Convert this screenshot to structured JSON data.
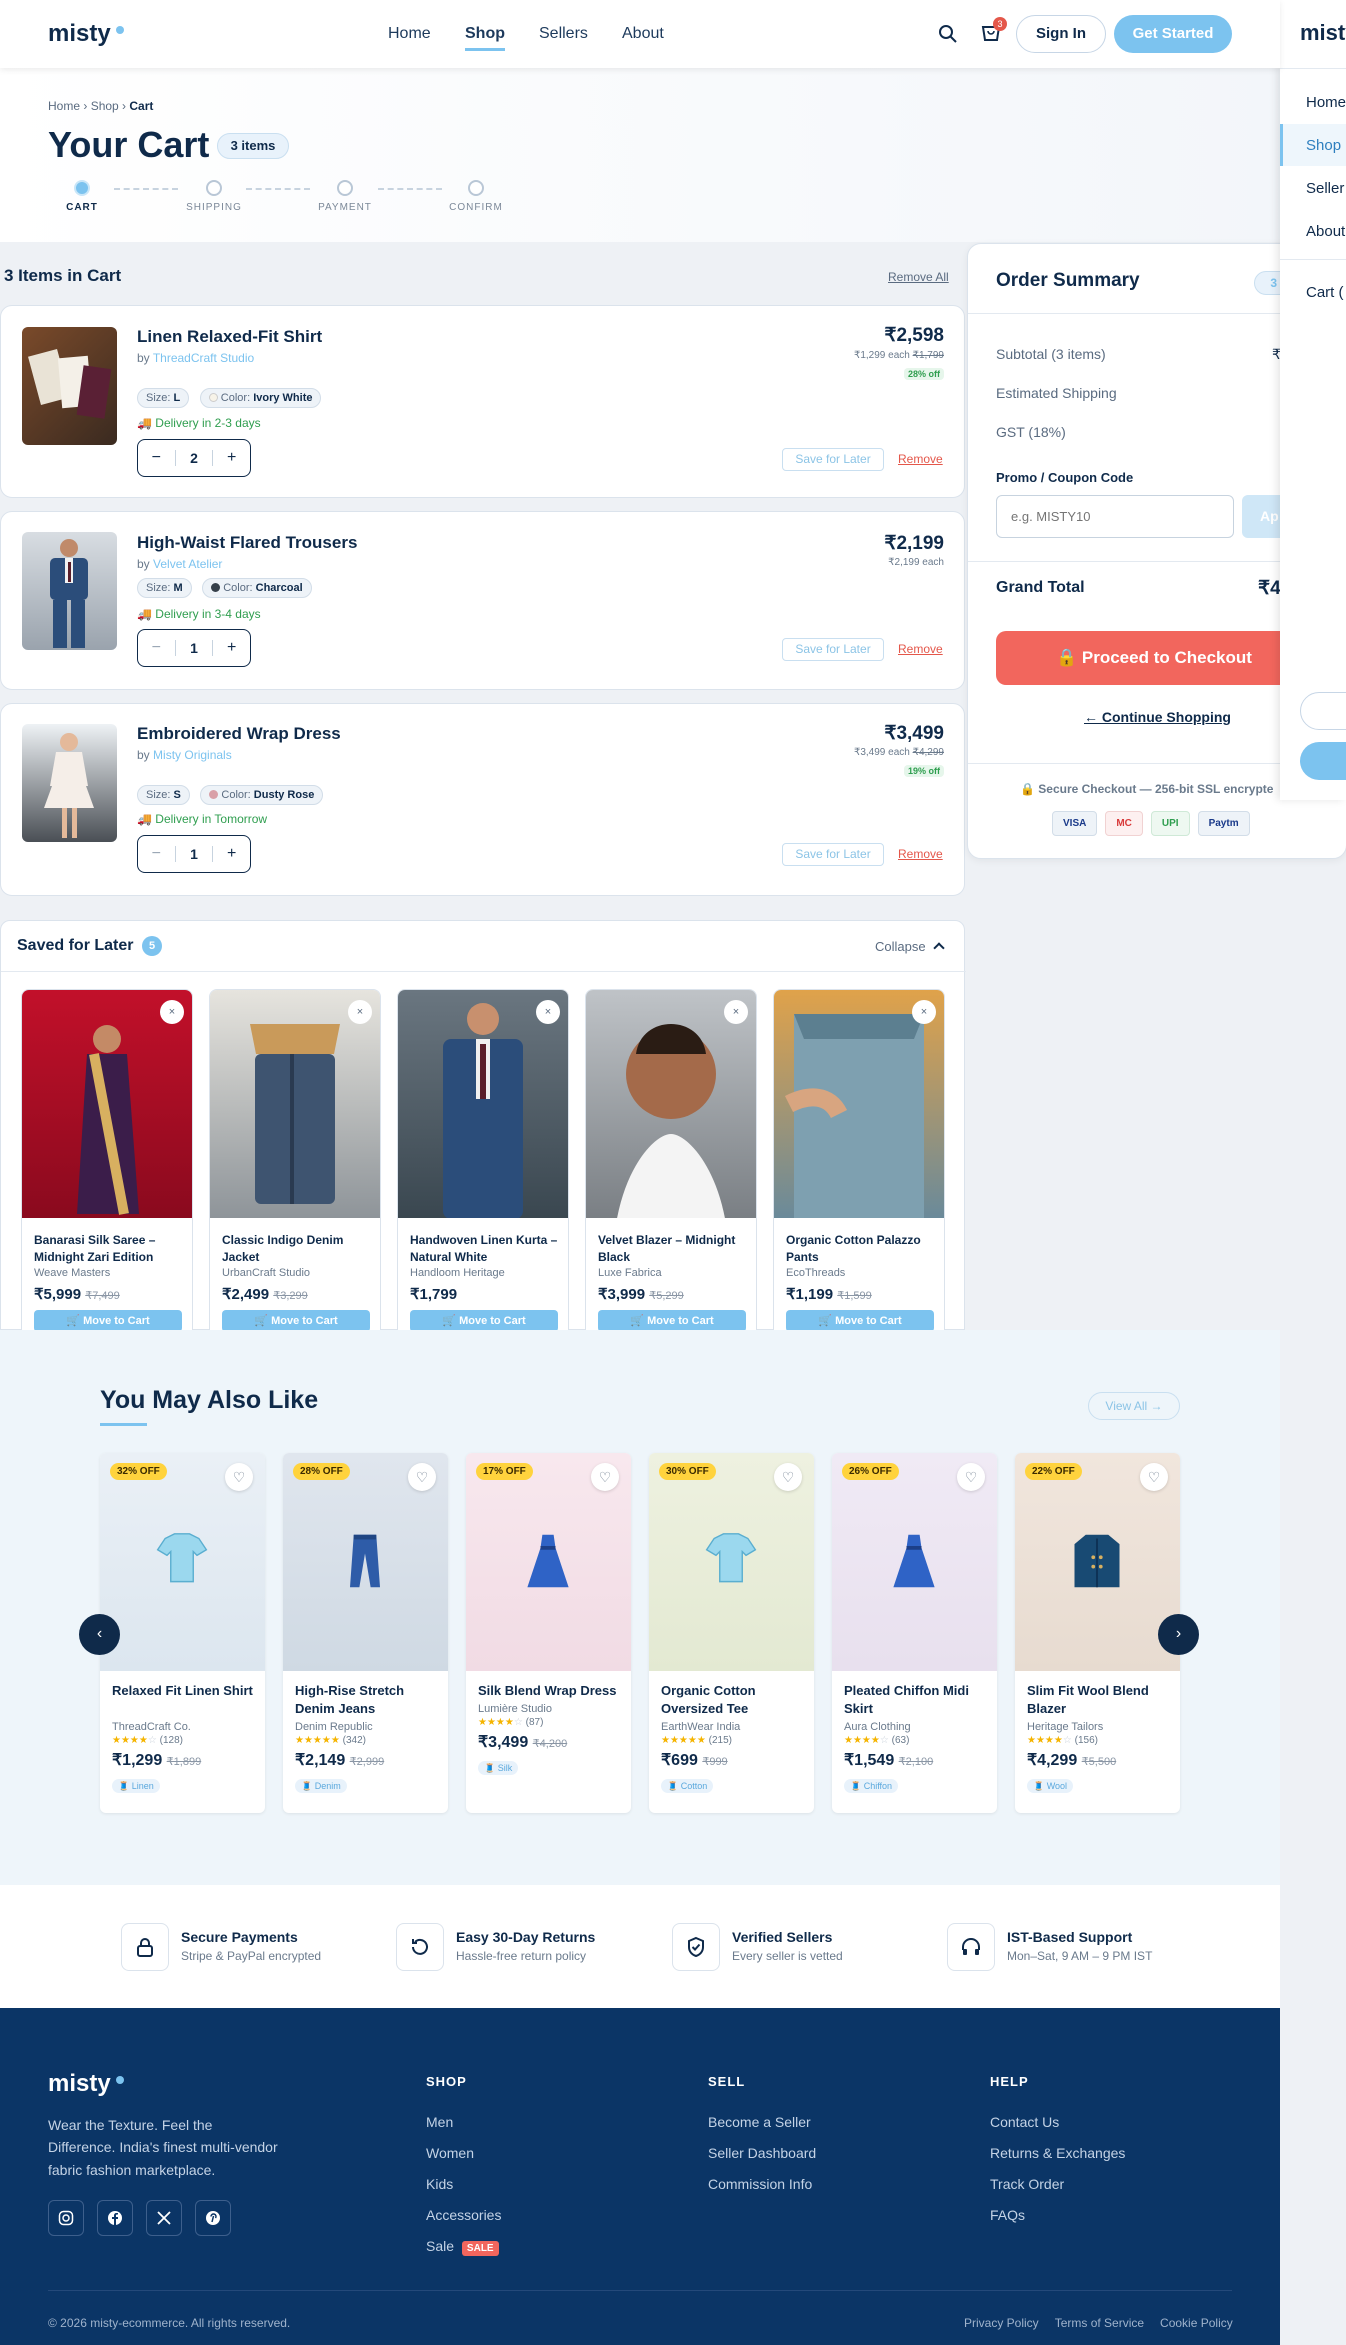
{
  "brand": {
    "name": "misty",
    "accent": "#7cc3ef",
    "navy": "#0f2a4a",
    "footer_bg": "#0b3566",
    "danger": "#e4574a",
    "success": "#2f9e4f"
  },
  "nav": {
    "links": [
      "Home",
      "Shop",
      "Sellers",
      "About"
    ],
    "active": "Shop",
    "cart_count": "3",
    "signin": "Sign In",
    "cta": "Get Started"
  },
  "breadcrumb": [
    "Home",
    "Shop",
    "Cart"
  ],
  "page": {
    "title": "Your Cart",
    "count_badge": "3 items"
  },
  "steps": [
    "CART",
    "SHIPPING",
    "PAYMENT",
    "CONFIRM"
  ],
  "cart": {
    "heading": "3 Items in Cart",
    "remove_all": "Remove All",
    "save_label": "Save for Later",
    "remove_label": "Remove",
    "items": [
      {
        "title": "Linen Relaxed-Fit Shirt",
        "by": "by",
        "seller": "ThreadCraft Studio",
        "size_label": "Size:",
        "size": "L",
        "color_label": "Color:",
        "color": "Ivory White",
        "delivery": "Delivery in 2-3 days",
        "qty": "2",
        "price": "₹2,598",
        "each": "₹1,299 each",
        "mrp": "₹1,799",
        "discount": "28% off"
      },
      {
        "title": "High-Waist Flared Trousers",
        "by": "by",
        "seller": "Velvet Atelier",
        "size_label": "Size:",
        "size": "M",
        "color_label": "Color:",
        "color": "Charcoal",
        "delivery": "Delivery in 3-4 days",
        "qty": "1",
        "price": "₹2,199",
        "each": "₹2,199 each",
        "mrp": "",
        "discount": ""
      },
      {
        "title": "Embroidered Wrap Dress",
        "by": "by",
        "seller": "Misty Originals",
        "size_label": "Size:",
        "size": "S",
        "color_label": "Color:",
        "color": "Dusty Rose",
        "delivery": "Delivery in Tomorrow",
        "qty": "1",
        "price": "₹3,499",
        "each": "₹3,499 each",
        "mrp": "₹4,299",
        "discount": "19% off"
      }
    ]
  },
  "summary": {
    "title": "Order Summary",
    "items_badge": "3 it",
    "subtotal": "Subtotal (3 items)",
    "subtotal_val": "₹",
    "shipping": "Estimated Shipping",
    "shipping_val": "",
    "gst": "GST (18%)",
    "promo_label": "Promo / Coupon Code",
    "promo_placeholder": "e.g. MISTY10",
    "apply": "Ap",
    "grand": "Grand Total",
    "grand_val": "₹4",
    "checkout": "Proceed to Checkout",
    "continue": "← Continue Shopping",
    "secure": "Secure Checkout — 256-bit SSL encrypte",
    "payments": [
      "VISA",
      "MC",
      "UPI",
      "Paytm"
    ]
  },
  "saved": {
    "title": "Saved for Later",
    "count": "5",
    "collapse": "Collapse",
    "move": "Move to Cart",
    "items": [
      {
        "title": "Banarasi Silk Saree – Midnight Zari Edition",
        "brand": "Weave Masters",
        "price": "₹5,999",
        "mrp": "₹7,499"
      },
      {
        "title": "Classic Indigo Denim Jacket",
        "brand": "UrbanCraft Studio",
        "price": "₹2,499",
        "mrp": "₹3,299"
      },
      {
        "title": "Handwoven Linen Kurta – Natural White",
        "brand": "Handloom Heritage",
        "price": "₹1,799",
        "mrp": ""
      },
      {
        "title": "Velvet Blazer – Midnight Black",
        "brand": "Luxe Fabrica",
        "price": "₹3,999",
        "mrp": "₹5,299"
      },
      {
        "title": "Organic Cotton Palazzo Pants",
        "brand": "EcoThreads",
        "price": "₹1,199",
        "mrp": "₹1,599"
      }
    ]
  },
  "recs": {
    "title": "You May Also Like",
    "view_all": "View All →",
    "items": [
      {
        "badge": "32% OFF",
        "title": "Relaxed Fit Linen Shirt",
        "brand": "ThreadCraft Co.",
        "stars": "★★★★☆",
        "reviews": "(128)",
        "price": "₹1,299",
        "mrp": "₹1,899",
        "fabric": "Linen",
        "icon": "tshirt-icon"
      },
      {
        "badge": "28% OFF",
        "title": "High-Rise Stretch Denim Jeans",
        "brand": "Denim Republic",
        "stars": "★★★★★",
        "reviews": "(342)",
        "price": "₹2,149",
        "mrp": "₹2,999",
        "fabric": "Denim",
        "icon": "jeans-icon"
      },
      {
        "badge": "17% OFF",
        "title": "Silk Blend Wrap Dress",
        "brand": "Lumière Studio",
        "stars": "★★★★☆",
        "reviews": "(87)",
        "price": "₹3,499",
        "mrp": "₹4,200",
        "fabric": "Silk",
        "icon": "dress-icon"
      },
      {
        "badge": "30% OFF",
        "title": "Organic Cotton Oversized Tee",
        "brand": "EarthWear India",
        "stars": "★★★★★",
        "reviews": "(215)",
        "price": "₹699",
        "mrp": "₹999",
        "fabric": "Cotton",
        "icon": "tshirt-icon"
      },
      {
        "badge": "26% OFF",
        "title": "Pleated Chiffon Midi Skirt",
        "brand": "Aura Clothing",
        "stars": "★★★★☆",
        "reviews": "(63)",
        "price": "₹1,549",
        "mrp": "₹2,100",
        "fabric": "Chiffon",
        "icon": "dress-icon"
      },
      {
        "badge": "22% OFF",
        "title": "Slim Fit Wool Blend Blazer",
        "brand": "Heritage Tailors",
        "stars": "★★★★☆",
        "reviews": "(156)",
        "price": "₹4,299",
        "mrp": "₹5,500",
        "fabric": "Wool",
        "icon": "coat-icon"
      }
    ]
  },
  "trust": [
    {
      "title": "Secure Payments",
      "sub": "Stripe & PayPal encrypted"
    },
    {
      "title": "Easy 30-Day Returns",
      "sub": "Hassle-free return policy"
    },
    {
      "title": "Verified Sellers",
      "sub": "Every seller is vetted"
    },
    {
      "title": "IST-Based Support",
      "sub": "Mon–Sat, 9 AM – 9 PM IST"
    }
  ],
  "footer": {
    "tagline": "Wear the Texture. Feel the Difference. India's finest multi-vendor fabric fashion marketplace.",
    "cols": [
      {
        "h": "SHOP",
        "links": [
          "Men",
          "Women",
          "Kids",
          "Accessories",
          "Sale"
        ]
      },
      {
        "h": "SELL",
        "links": [
          "Become a Seller",
          "Seller Dashboard",
          "Commission Info"
        ]
      },
      {
        "h": "HELP",
        "links": [
          "Contact Us",
          "Returns & Exchanges",
          "Track Order",
          "FAQs"
        ]
      }
    ],
    "sale_badge": "SALE",
    "copyright": "© 2026 misty-ecommerce. All rights reserved.",
    "legal": [
      "Privacy Policy",
      "Terms of Service",
      "Cookie Policy"
    ]
  },
  "side": {
    "brand": "misty",
    "links": [
      "Home",
      "Shop",
      "Seller",
      "About",
      "Cart ("
    ]
  }
}
